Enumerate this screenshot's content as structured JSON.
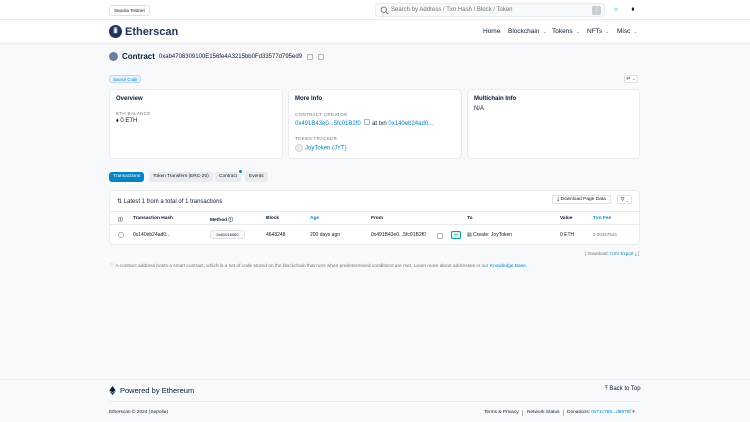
{
  "topbar": {
    "network_badge": "Sepolia Testnet",
    "search_placeholder": "Search by Address / Txn Hash / Block / Token",
    "slash_key": "/"
  },
  "nav": {
    "brand": "Etherscan",
    "items": [
      {
        "label": "Home",
        "has_dropdown": false
      },
      {
        "label": "Blockchain",
        "has_dropdown": true
      },
      {
        "label": "Tokens",
        "has_dropdown": true
      },
      {
        "label": "NFTs",
        "has_dropdown": true
      },
      {
        "label": "Misc",
        "has_dropdown": true
      }
    ]
  },
  "contract": {
    "label": "Contract",
    "address": "0xab4708309100E156fe4A3215bb0Fd33577d795ed9",
    "source_tag": "Source Code"
  },
  "overview": {
    "title": "Overview",
    "balance_label": "ETH BALANCE",
    "balance_value": "0 ETH"
  },
  "more_info": {
    "title": "More Info",
    "creator_label": "CONTRACT CREATOR",
    "creator_address": "0x491B43e0...5fc01B2f0",
    "at_txn_text": "at txn",
    "creation_txn": "0x140eb24ad0...",
    "tracker_label": "TOKEN TRACKER",
    "token_name": "JoyToken (JYT)"
  },
  "multichain": {
    "title": "Multichain Info",
    "value": "N/A"
  },
  "tabs": [
    {
      "label": "Transactions",
      "active": true
    },
    {
      "label": "Token Transfers (ERC-20)",
      "active": false
    },
    {
      "label": "Contract",
      "active": false
    },
    {
      "label": "Events",
      "active": false
    }
  ],
  "transactions": {
    "summary": "Latest 1 from a total of 1 transactions",
    "download_label": "Download Page Data",
    "columns": [
      "Transaction Hash",
      "Method",
      "Block",
      "Age",
      "From",
      "To",
      "Value",
      "Txn Fee"
    ],
    "rows": [
      {
        "hash": "0x140eb24ad0...",
        "method": "0x61016060",
        "block": "4643248",
        "age": "200 days ago",
        "from": "0x491B43e0...5fc01B2f0",
        "direction": "IN",
        "to": "Create: JoyToken",
        "value": "0 ETH",
        "fee": "0.00427643"
      }
    ],
    "download_note_prefix": "[ Download:",
    "download_note_link": "CSV Export",
    "download_note_suffix": "]"
  },
  "info_note": {
    "text": "A contract address hosts a smart contract, which is a set of code stored on the blockchain that runs when predetermined conditions are met. Learn more about addresses in our",
    "link": "Knowledge Base."
  },
  "footer": {
    "powered_by": "Powered by Ethereum",
    "back_to_top": "Back to Top",
    "copyright": "Etherscan © 2024 (Sepolia)",
    "terms": "Terms & Privacy",
    "status": "Network Status",
    "donations_label": "Donations:",
    "donations_address": "0x71c765...d8976f"
  },
  "colors": {
    "accent": "#0784c3",
    "brand": "#21325b",
    "text": "#081d35",
    "muted": "#6c757d",
    "heart": "#dc3545"
  }
}
